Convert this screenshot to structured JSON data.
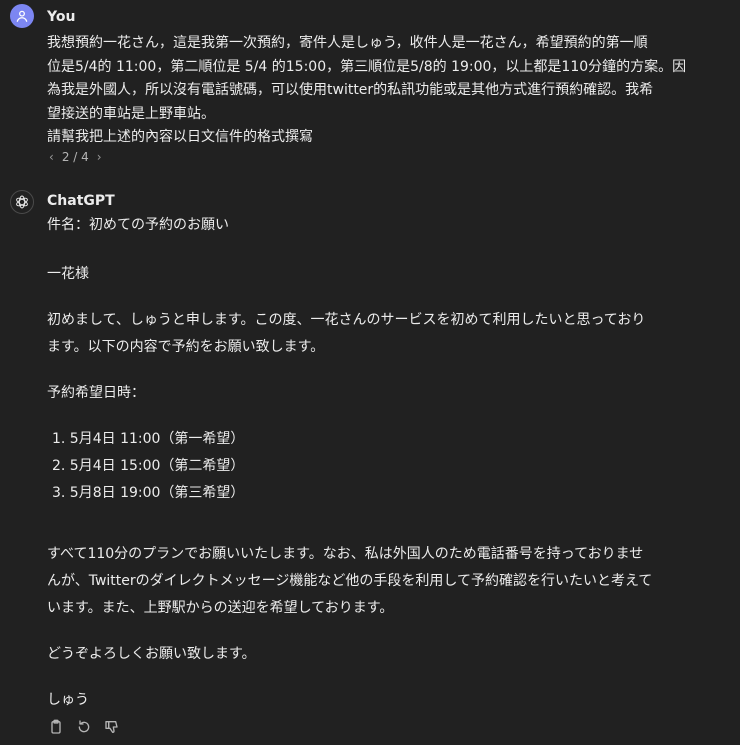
{
  "user": {
    "name": "You",
    "message_lines": [
      "我想預約一花さん，這是我第一次預約，寄件人是しゅう，收件人是一花さん，希望預約的第一順",
      "位是5/4的 11:00，第二順位是 5/4 的15:00，第三順位是5/8的 19:00，以上都是110分鐘的方案。因",
      "為我是外國人，所以沒有電話號碼，可以使用twitter的私訊功能或是其他方式進行預約確認。我希",
      "望接送的車站是上野車站。",
      "請幫我把上述的內容以日文信件的格式撰寫"
    ],
    "pager": "2 / 4"
  },
  "assistant": {
    "name": "ChatGPT",
    "subject": "件名：初めての予約のお願い",
    "greeting": "一花様",
    "intro_lines": [
      "初めまして、しゅうと申します。この度、一花さんのサービスを初めて利用したいと思っており",
      "ます。以下の内容で予約をお願い致します。"
    ],
    "schedule_heading": "予約希望日時：",
    "schedule": [
      "1. 5月4日 11:00（第一希望）",
      "2. 5月4日 15:00（第二希望）",
      "3. 5月8日 19:00（第三希望）"
    ],
    "body_lines": [
      "すべて110分のプランでお願いいたします。なお、私は外国人のため電話番号を持っておりませ",
      "んが、Twitterのダイレクトメッセージ機能など他の手段を利用して予約確認を行いたいと考えて",
      "います。また、上野駅からの送迎を希望しております。"
    ],
    "closing": "どうぞよろしくお願い致します。",
    "signature": "しゅう"
  },
  "icons": {
    "user_avatar": "person-icon",
    "assistant_avatar": "openai-logo-icon",
    "copy": "clipboard-icon",
    "regenerate": "refresh-icon",
    "dislike": "thumbs-down-icon"
  },
  "colors": {
    "background": "#212121",
    "text": "#ececec",
    "muted": "#b4b4b4",
    "user_avatar": "#7c86f2"
  }
}
